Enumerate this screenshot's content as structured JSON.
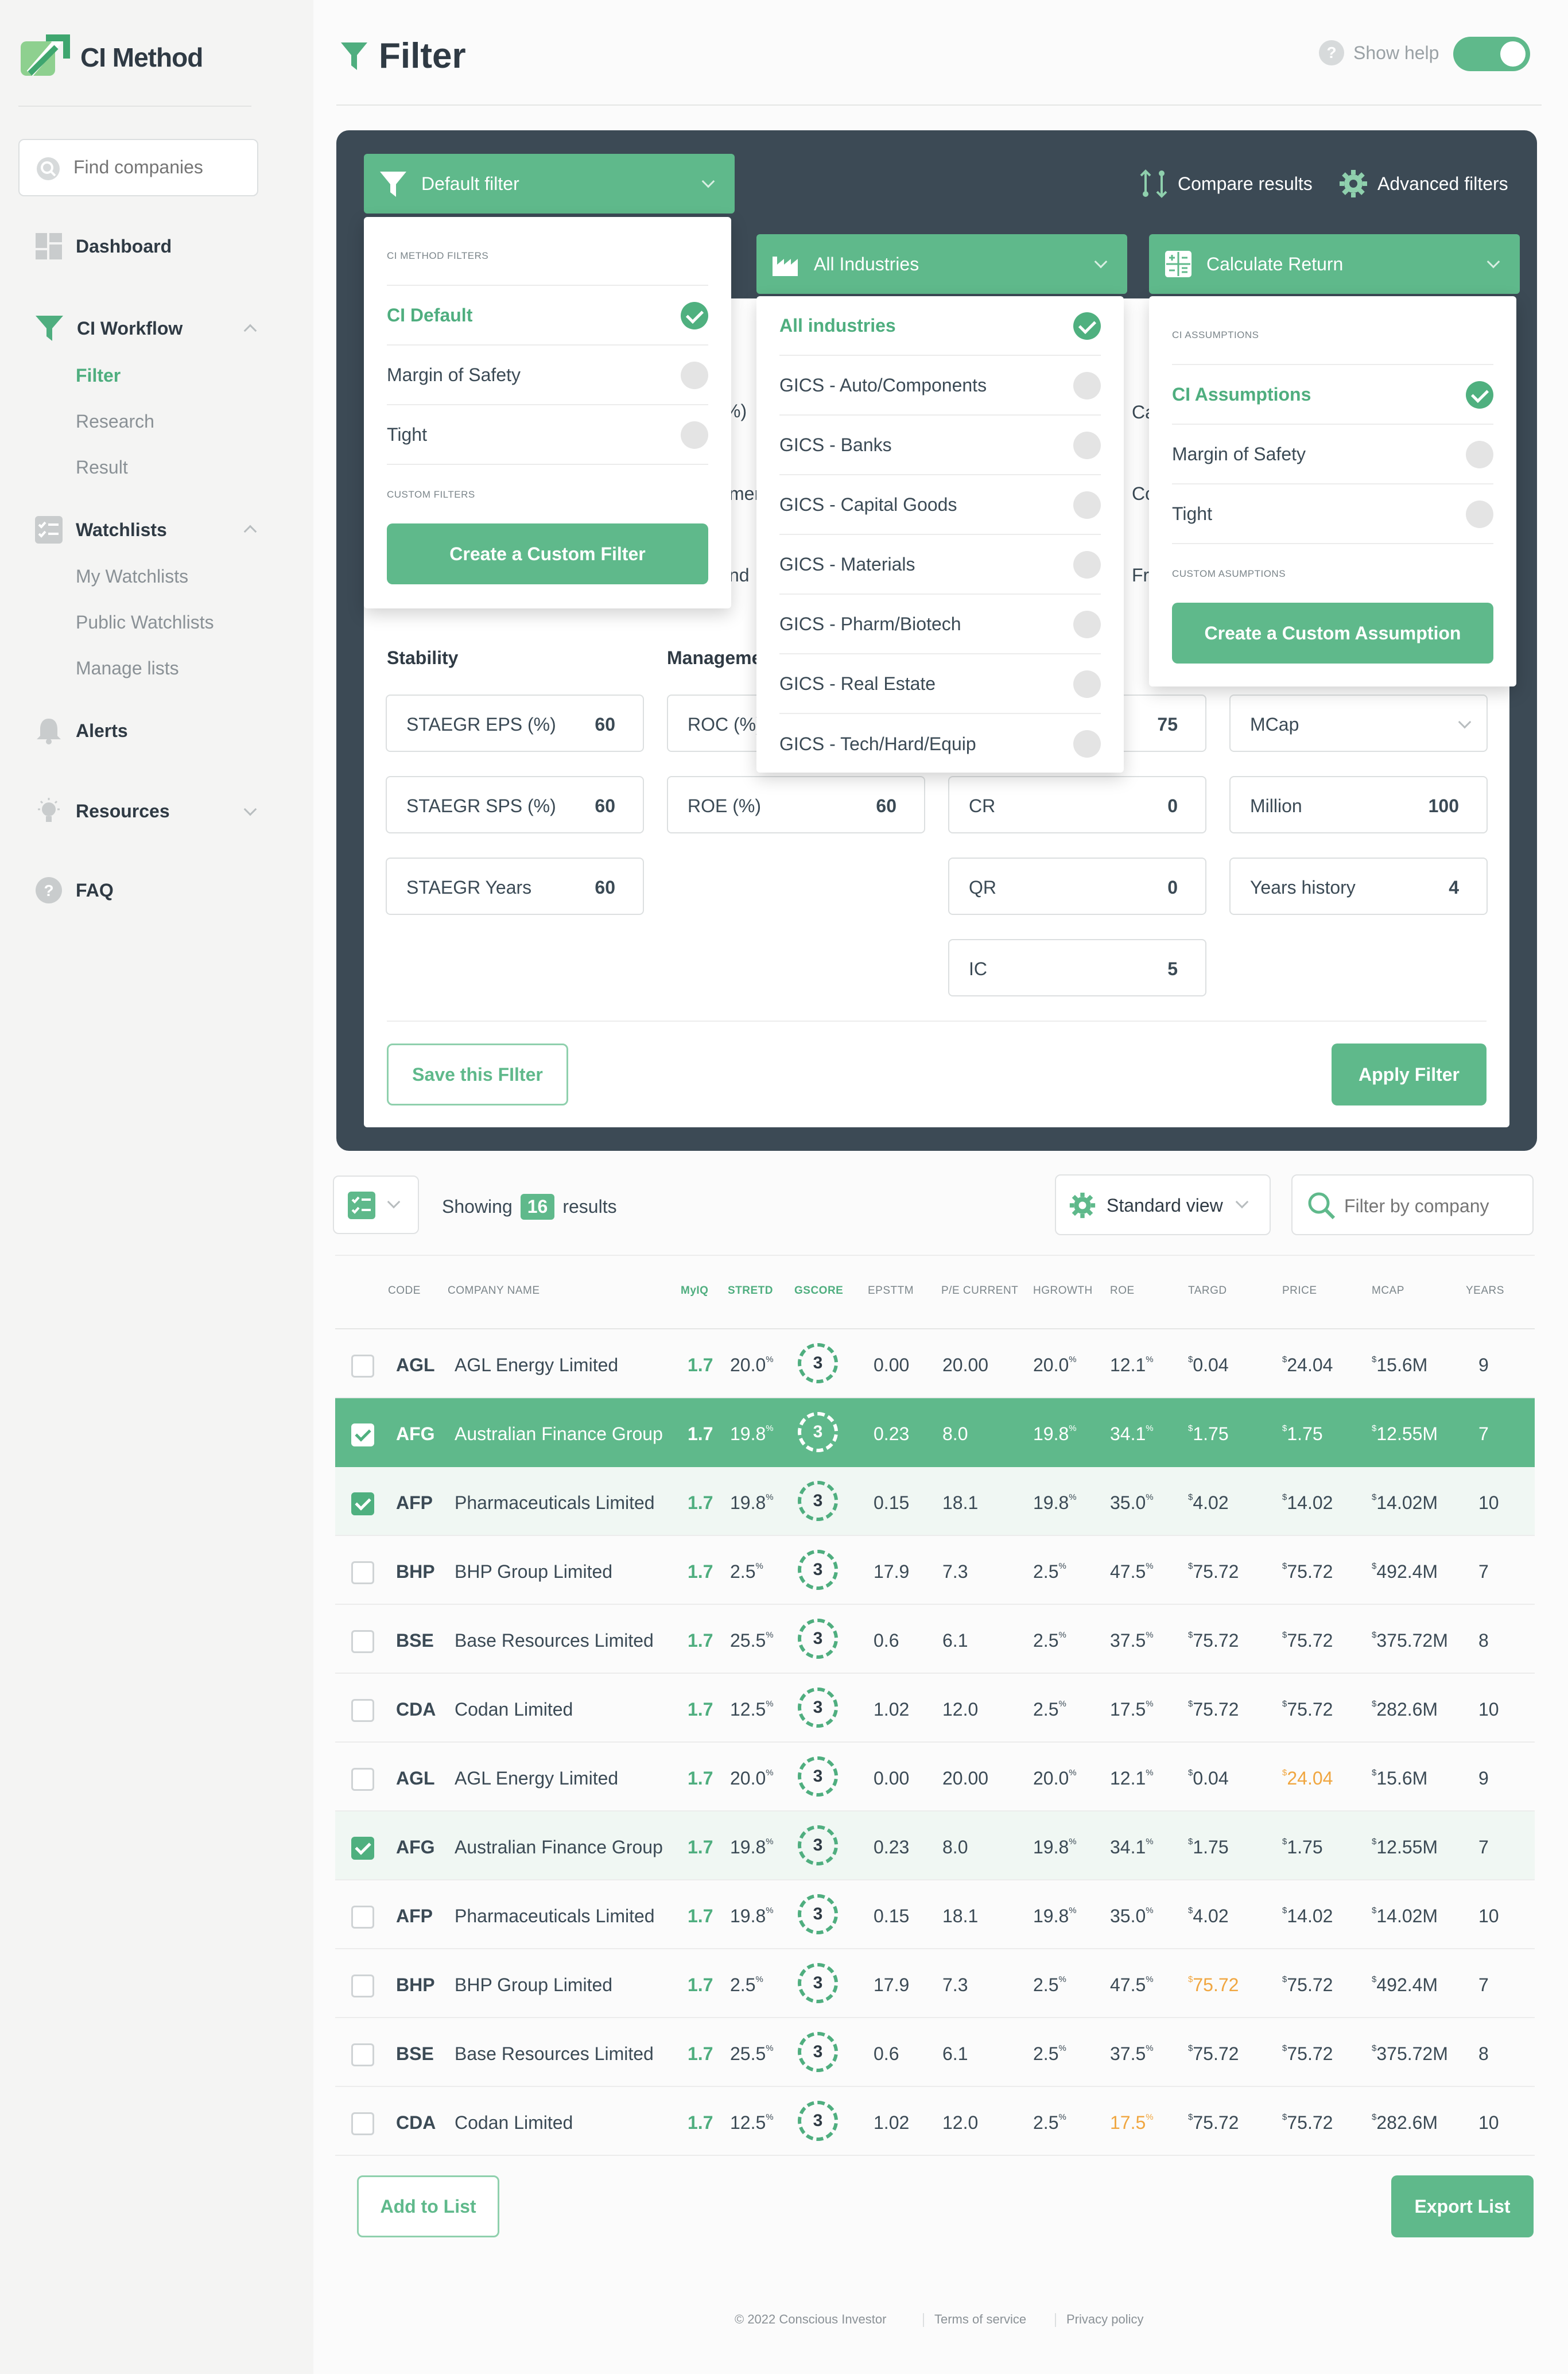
{
  "brand": {
    "name": "CI Method"
  },
  "sidebar": {
    "search_placeholder": "Find companies",
    "dashboard": "Dashboard",
    "workflow": {
      "label": "CI Workflow",
      "items": [
        "Filter",
        "Research",
        "Result"
      ]
    },
    "watchlists": {
      "label": "Watchlists",
      "items": [
        "My Watchlists",
        "Public Watchlists",
        "Manage lists"
      ]
    },
    "alerts": "Alerts",
    "resources": "Resources",
    "faq": "FAQ"
  },
  "header": {
    "title": "Filter",
    "help_label": "Show help",
    "help_on": true
  },
  "toolbar": {
    "filter_dropdown": "Default filter",
    "compare": "Compare results",
    "advanced": "Advanced filters",
    "industries_dropdown": "All Industries",
    "return_dropdown": "Calculate Return"
  },
  "filter_menu": {
    "section1": "CI METHOD FILTERS",
    "options": [
      {
        "label": "CI Default",
        "selected": true
      },
      {
        "label": "Margin of Safety",
        "selected": false
      },
      {
        "label": "Tight",
        "selected": false
      }
    ],
    "section2": "CUSTOM FILTERS",
    "create_label": "Create a Custom Filter"
  },
  "industry_menu": {
    "options": [
      {
        "label": "All industries",
        "selected": true
      },
      {
        "label": "GICS - Auto/Components",
        "selected": false
      },
      {
        "label": "GICS - Banks",
        "selected": false
      },
      {
        "label": "GICS - Capital Goods",
        "selected": false
      },
      {
        "label": "GICS - Materials",
        "selected": false
      },
      {
        "label": "GICS - Pharm/Biotech",
        "selected": false
      },
      {
        "label": "GICS - Real Estate",
        "selected": false
      },
      {
        "label": "GICS - Tech/Hard/Equip",
        "selected": false
      }
    ]
  },
  "return_menu": {
    "section1": "CI ASSUMPTIONS",
    "options": [
      {
        "label": "CI Assumptions",
        "selected": true
      },
      {
        "label": "Margin of Safety",
        "selected": false
      },
      {
        "label": "Tight",
        "selected": false
      }
    ],
    "section2": "CUSTOM ASUMPTIONS",
    "create_label": "Create a Custom Assumption"
  },
  "peek_text": {
    "a": "%)",
    "b": "mer",
    "c": "nd",
    "d": "Ca",
    "e": "Co",
    "f": "Fr",
    "g": "75"
  },
  "criteria": {
    "stability": {
      "heading": "Stability",
      "fields": [
        {
          "label": "STAEGR EPS (%)",
          "value": "60"
        },
        {
          "label": "STAEGR SPS (%)",
          "value": "60"
        },
        {
          "label": "STAEGR Years",
          "value": "60"
        }
      ]
    },
    "management": {
      "heading": "Management",
      "fields": [
        {
          "label": "ROC (%)",
          "value": ""
        },
        {
          "label": "ROE (%)",
          "value": "60"
        }
      ]
    },
    "liquidity": {
      "fields": [
        {
          "label": "CR",
          "value": "0"
        },
        {
          "label": "QR",
          "value": "0"
        },
        {
          "label": "IC",
          "value": "5"
        }
      ]
    },
    "size": {
      "mcap": "MCap",
      "fields": [
        {
          "label": "Million",
          "value": "100"
        },
        {
          "label": "Years history",
          "value": "4"
        }
      ]
    }
  },
  "actions": {
    "save": "Save this FIlter",
    "apply": "Apply Filter"
  },
  "results_bar": {
    "showing": "Showing",
    "count": "16",
    "results": "results",
    "view": "Standard view",
    "filter_placeholder": "Filter by company"
  },
  "table": {
    "headers": [
      "CODE",
      "COMPANY NAME",
      "MyIQ",
      "STRETD",
      "GSCORE",
      "EPSTTM",
      "P/E CURRENT",
      "HGROWTH",
      "ROE",
      "TARGD",
      "PRICE",
      "MCAP",
      "YEARS"
    ],
    "rows": [
      {
        "checked": false,
        "style": "",
        "code": "AGL",
        "name": "AGL Energy Limited",
        "myiq": "1.7",
        "stretd": "20.0",
        "gscore": "3",
        "eps": "0.00",
        "pe": "20.00",
        "hgrowth": "20.0",
        "roe": "12.1",
        "targd": "0.04",
        "price": "24.04",
        "mcap": "15.6M",
        "years": "9"
      },
      {
        "checked": true,
        "style": "sel",
        "code": "AFG",
        "name": "Australian Finance Group",
        "myiq": "1.7",
        "stretd": "19.8",
        "gscore": "3",
        "eps": "0.23",
        "pe": "8.0",
        "hgrowth": "19.8",
        "roe": "34.1",
        "targd": "1.75",
        "price": "1.75",
        "mcap": "12.55M",
        "years": "7"
      },
      {
        "checked": true,
        "style": "light",
        "code": "AFP",
        "name": "Pharmaceuticals Limited",
        "myiq": "1.7",
        "stretd": "19.8",
        "gscore": "3",
        "eps": "0.15",
        "pe": "18.1",
        "hgrowth": "19.8",
        "roe": "35.0",
        "targd": "4.02",
        "price": "14.02",
        "mcap": "14.02M",
        "years": "10"
      },
      {
        "checked": false,
        "style": "",
        "code": "BHP",
        "name": "BHP Group Limited",
        "myiq": "1.7",
        "stretd": "2.5",
        "gscore": "3",
        "eps": "17.9",
        "pe": "7.3",
        "hgrowth": "2.5",
        "roe": "47.5",
        "targd": "75.72",
        "price": "75.72",
        "mcap": "492.4M",
        "years": "7"
      },
      {
        "checked": false,
        "style": "",
        "code": "BSE",
        "name": "Base Resources Limited",
        "myiq": "1.7",
        "stretd": "25.5",
        "gscore": "3",
        "eps": "0.6",
        "pe": "6.1",
        "hgrowth": "2.5",
        "roe": "37.5",
        "targd": "75.72",
        "price": "75.72",
        "mcap": "375.72M",
        "years": "8"
      },
      {
        "checked": false,
        "style": "",
        "code": "CDA",
        "name": "Codan Limited",
        "myiq": "1.7",
        "stretd": "12.5",
        "gscore": "3",
        "eps": "1.02",
        "pe": "12.0",
        "hgrowth": "2.5",
        "roe": "17.5",
        "targd": "75.72",
        "price": "75.72",
        "mcap": "282.6M",
        "years": "10"
      },
      {
        "checked": false,
        "style": "",
        "code": "AGL",
        "name": "AGL Energy Limited",
        "myiq": "1.7",
        "stretd": "20.0",
        "gscore": "3",
        "eps": "0.00",
        "pe": "20.00",
        "hgrowth": "20.0",
        "roe": "12.1",
        "targd": "0.04",
        "price": "24.04",
        "mcap": "15.6M",
        "years": "9",
        "warn": "price"
      },
      {
        "checked": true,
        "style": "light",
        "code": "AFG",
        "name": "Australian Finance Group",
        "myiq": "1.7",
        "stretd": "19.8",
        "gscore": "3",
        "eps": "0.23",
        "pe": "8.0",
        "hgrowth": "19.8",
        "roe": "34.1",
        "targd": "1.75",
        "price": "1.75",
        "mcap": "12.55M",
        "years": "7"
      },
      {
        "checked": false,
        "style": "",
        "code": "AFP",
        "name": "Pharmaceuticals Limited",
        "myiq": "1.7",
        "stretd": "19.8",
        "gscore": "3",
        "eps": "0.15",
        "pe": "18.1",
        "hgrowth": "19.8",
        "roe": "35.0",
        "targd": "4.02",
        "price": "14.02",
        "mcap": "14.02M",
        "years": "10"
      },
      {
        "checked": false,
        "style": "",
        "code": "BHP",
        "name": "BHP Group Limited",
        "myiq": "1.7",
        "stretd": "2.5",
        "gscore": "3",
        "eps": "17.9",
        "pe": "7.3",
        "hgrowth": "2.5",
        "roe": "47.5",
        "targd": "75.72",
        "price": "75.72",
        "mcap": "492.4M",
        "years": "7",
        "warn": "targd"
      },
      {
        "checked": false,
        "style": "",
        "code": "BSE",
        "name": "Base Resources Limited",
        "myiq": "1.7",
        "stretd": "25.5",
        "gscore": "3",
        "eps": "0.6",
        "pe": "6.1",
        "hgrowth": "2.5",
        "roe": "37.5",
        "targd": "75.72",
        "price": "75.72",
        "mcap": "375.72M",
        "years": "8"
      },
      {
        "checked": false,
        "style": "",
        "code": "CDA",
        "name": "Codan Limited",
        "myiq": "1.7",
        "stretd": "12.5",
        "gscore": "3",
        "eps": "1.02",
        "pe": "12.0",
        "hgrowth": "2.5",
        "roe": "17.5",
        "targd": "75.72",
        "price": "75.72",
        "mcap": "282.6M",
        "years": "10",
        "warn": "roe"
      }
    ]
  },
  "bottom": {
    "add": "Add to List",
    "export": "Export List"
  },
  "footer": {
    "copyright": "© 2022 Conscious Investor",
    "terms": "Terms of service",
    "privacy": "Privacy policy"
  },
  "colors": {
    "accent": "#5fb98b",
    "panel": "#3c4a55",
    "warn": "#f0a640"
  },
  "icons": [
    "logo-icon",
    "search-icon",
    "dashboard-icon",
    "funnel-icon",
    "checklist-icon",
    "bell-icon",
    "bulb-icon",
    "help-icon",
    "compare-icon",
    "gear-icon",
    "factory-icon",
    "calculator-icon"
  ]
}
